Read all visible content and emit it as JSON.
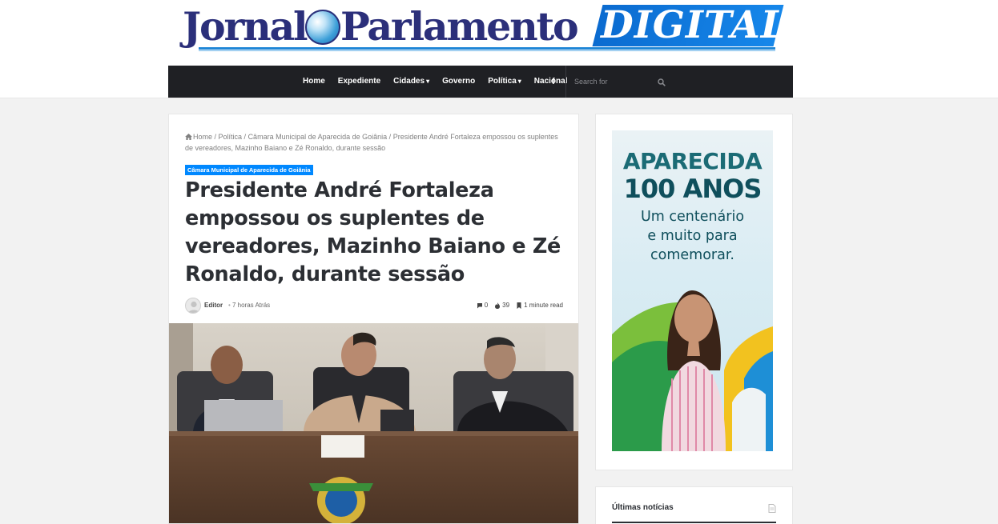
{
  "logo": {
    "part1": "Jornal",
    "part2": "Parlamento",
    "part3": "DIGITAL"
  },
  "nav": {
    "items": [
      {
        "label": "Home",
        "dropdown": false
      },
      {
        "label": "Expediente",
        "dropdown": false
      },
      {
        "label": "Cidades",
        "dropdown": true
      },
      {
        "label": "Governo",
        "dropdown": false
      },
      {
        "label": "Política",
        "dropdown": true
      },
      {
        "label": "Nacional",
        "dropdown": false
      }
    ],
    "facebook_icon": "f",
    "search_placeholder": "Search for"
  },
  "article": {
    "breadcrumb": {
      "home": "Home",
      "sep": " / ",
      "crumb1": "Política",
      "crumb2": "Câmara Municipal de Aparecida de Goiânia",
      "current": "Presidente André Fortaleza empossou os suplentes de vereadores, Mazinho Baiano e Zé Ronaldo, durante sessão"
    },
    "category": "Câmara Municipal de Aparecida de Goiânia",
    "title": "Presidente André Fortaleza empossou os suplentes de vereadores, Mazinho Baiano e Zé Ronaldo, durante sessão",
    "author": "Editor",
    "dot": "•",
    "time": "7 horas Atrás",
    "comments": "0",
    "views": "39",
    "read_time": "1 minute read"
  },
  "ad": {
    "line1": "APARECIDA",
    "line2": "100 ANOS",
    "sub1": "Um centenário",
    "sub2": "e muito para",
    "sub3": "comemorar."
  },
  "sidebar": {
    "latest_title": "Últimas notícias"
  },
  "colors": {
    "brand_blue": "#0088ff",
    "nav_bg": "#1f2024",
    "logo_navy": "#2b2f7a"
  }
}
